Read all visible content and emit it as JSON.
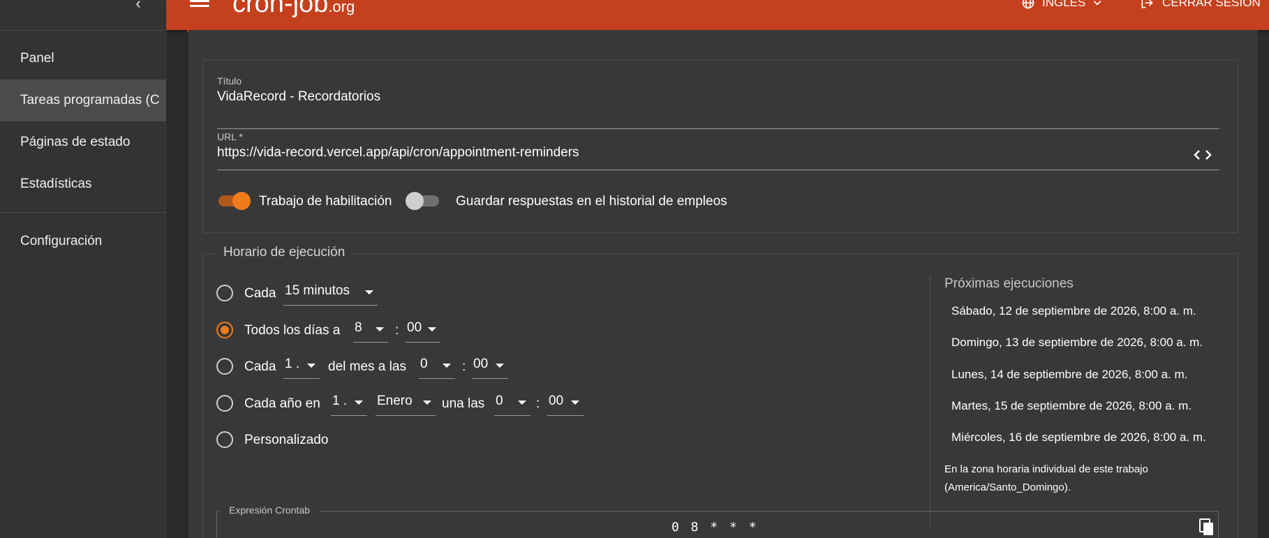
{
  "sidebar": {
    "items": [
      {
        "label": "Panel"
      },
      {
        "label": "Tareas programadas (C"
      },
      {
        "label": "Páginas de estado"
      },
      {
        "label": "Estadísticas"
      },
      {
        "label": "Configuración"
      }
    ],
    "active_index": 1
  },
  "header": {
    "logo_main": "cron-job",
    "logo_suffix": ".org",
    "language_label": "INGLÉS",
    "logout_label": "CERRAR SESIÓN",
    "brand_color": "#c5401d"
  },
  "job": {
    "title_label": "Título",
    "title_value": "VidaRecord - Recordatorios",
    "url_label": "URL *",
    "url_value": "https://vida-record.vercel.app/api/cron/appointment-reminders",
    "toggle_enable_label": "Trabajo de habilitación",
    "toggle_enable_on": true,
    "toggle_history_label": "Guardar respuestas en el historial de empleos",
    "toggle_history_on": false
  },
  "schedule": {
    "legend": "Horario de ejecución",
    "every_label": "Cada",
    "every_value": "15 minutos",
    "daily_label": "Todos los días a",
    "daily_hour": "8",
    "daily_minute": "00",
    "monthly_label": "Cada",
    "monthly_day": "1 .",
    "monthly_mid": "del mes a las",
    "monthly_hour": "0",
    "monthly_minute": "00",
    "yearly_label": "Cada año en",
    "yearly_day": "1 .",
    "yearly_month": "Enero",
    "yearly_mid": "una las",
    "yearly_hour": "0",
    "yearly_minute": "00",
    "custom_label": "Personalizado",
    "colon": ":",
    "selected": "daily",
    "accent_color": "#f07b1a"
  },
  "next_runs": {
    "title": "Próximas ejecuciones",
    "items": [
      "Sábado, 12 de septiembre de 2026, 8:00 a. m.",
      "Domingo, 13 de septiembre de 2026, 8:00 a. m.",
      "Lunes, 14 de septiembre de 2026, 8:00 a. m.",
      "Martes, 15 de septiembre de 2026, 8:00 a. m.",
      "Miércoles, 16 de septiembre de 2026, 8:00 a. m."
    ],
    "timezone_note": "En la zona horaria individual de este trabajo (America/Santo_Domingo)."
  },
  "crontab": {
    "legend": "Expresión Crontab",
    "expression": "0 8 * * *"
  }
}
